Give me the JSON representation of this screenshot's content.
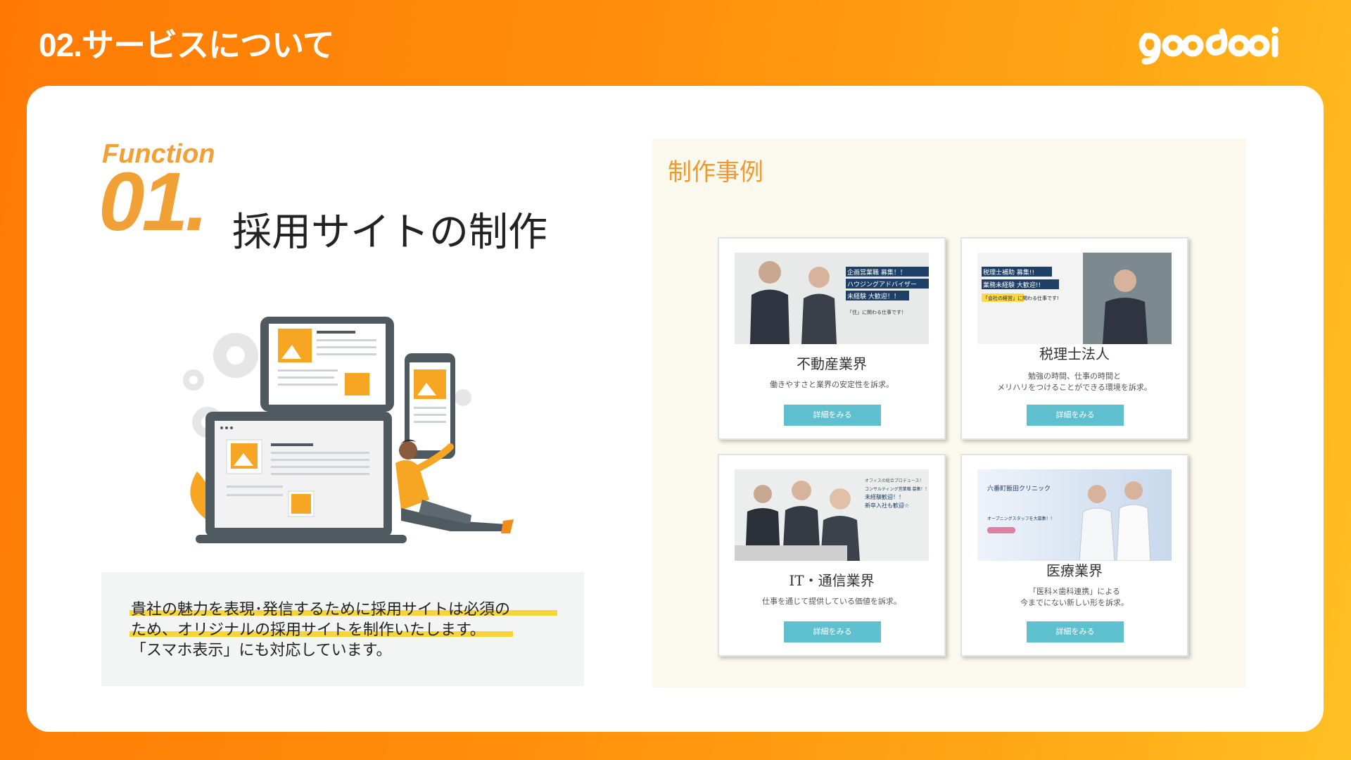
{
  "header": {
    "title": "02.サービスについて",
    "logo_text": "goodooi"
  },
  "function": {
    "label": "Function",
    "number": "01.",
    "title": "採用サイトの制作",
    "description_lines": [
      "貴社の魅力を表現･発信するために採用サイトは必須の",
      "ため、オリジナルの採用サイトを制作いたします。",
      "「スマホ表示」にも対応しています。"
    ]
  },
  "examples": {
    "title": "制作事例",
    "items": [
      {
        "title": "不動産業界",
        "desc": [
          "働きやすさと業界の安定性を訴求。"
        ],
        "button": "詳細をみる",
        "image_text": [
          "企画営業職 募集！！",
          "ハウジングアドバイザー",
          "未経験 大歓迎！！",
          "「住」に関わる仕事です！"
        ]
      },
      {
        "title": "税理士法人",
        "desc": [
          "勉強の時間、仕事の時間と",
          "メリハリをつけることができる環境を訴求。"
        ],
        "button": "詳細をみる",
        "image_text": [
          "税理士補助 募集!!",
          "業務未経験 大歓迎!!",
          "「会社の経営」に関わる仕事です!"
        ]
      },
      {
        "title": "IT・通信業界",
        "desc": [
          "仕事を通じて提供している価値を訴求。"
        ],
        "button": "詳細をみる",
        "image_text": [
          "オフィスの総合プロデュース！",
          "コンサルティング営業職 募集！！",
          "未経験歓迎！！",
          "新卒入社も歓迎☆"
        ]
      },
      {
        "title": "医療業界",
        "desc": [
          "「医科×歯科連携」による",
          "今までにない新しい形を訴求。"
        ],
        "button": "詳細をみる",
        "image_text": [
          "六番町飯田クリニック",
          "オープニングスタッフを大募集！！"
        ]
      }
    ]
  },
  "colors": {
    "accent_orange": "#f0a035",
    "button_teal": "#5ec0cf",
    "highlight_yellow": "#f5d53a",
    "background_gradient_start": "#ff7a05",
    "background_gradient_end": "#ffc022"
  }
}
